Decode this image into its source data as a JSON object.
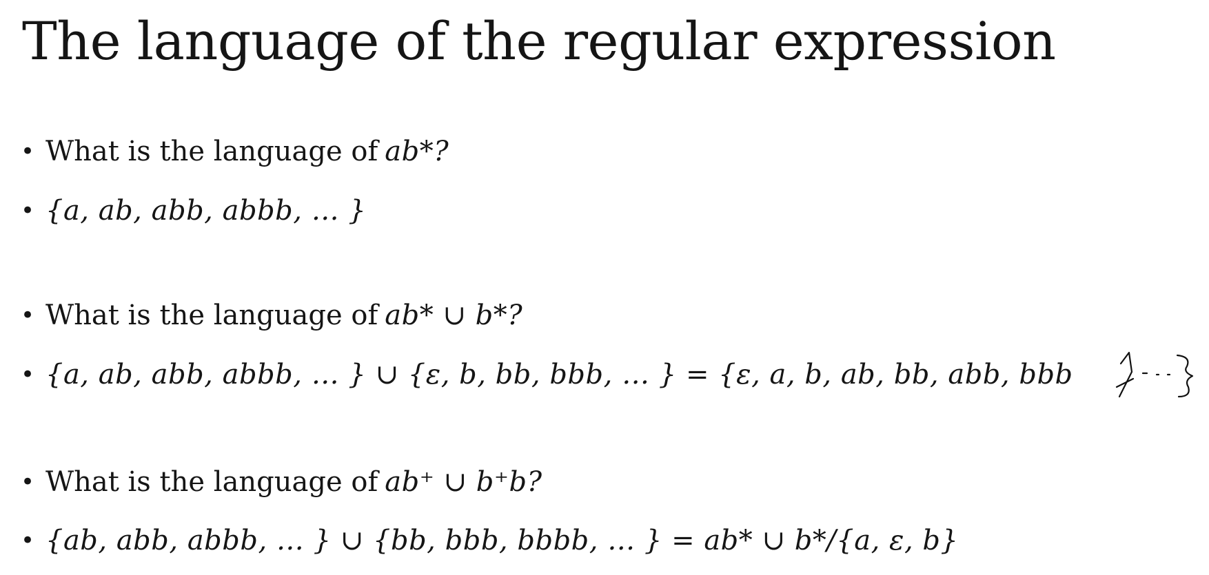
{
  "slide": {
    "title": "The language of the regular expression"
  },
  "items": [
    {
      "bullet": "•",
      "question": "What is the language of ",
      "expression": "ab*?"
    },
    {
      "bullet": "•",
      "answer": "{a, ab, abb, abbb, … }"
    },
    {
      "bullet": "•",
      "question": "What is the language of ",
      "expression": "ab* ∪ b*?"
    },
    {
      "bullet": "•",
      "answer": "{a, ab, abb, abbb, … } ∪ {ε, b, bb, bbb, … } = {ε, a, b, ab, bb, abb, bbb"
    },
    {
      "bullet": "•",
      "question": "What is the language of ",
      "expression": "ab⁺ ∪ b⁺b?"
    },
    {
      "bullet": "•",
      "answer": "{ab, abb, abbb, … } ∪ {bb, bbb, bbbb, … } = ab* ∪ b*/{a, ε, b}"
    }
  ],
  "annotation": {
    "icon": "handwritten-closing-brace"
  }
}
